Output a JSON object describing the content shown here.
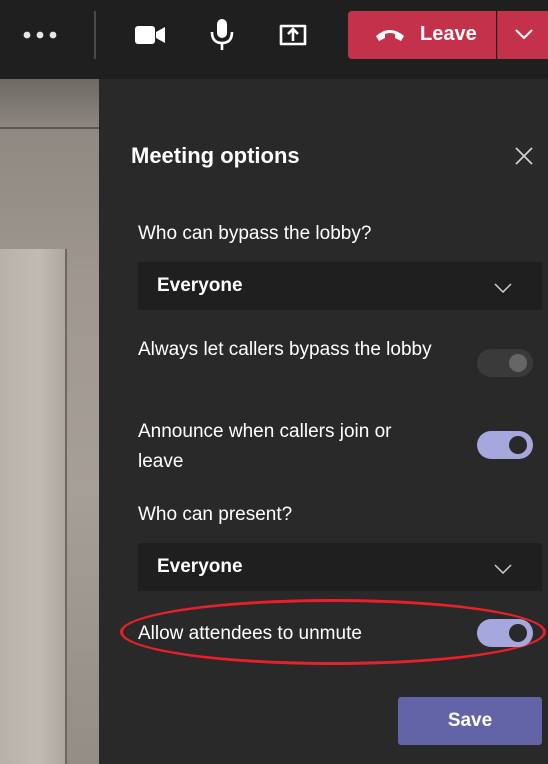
{
  "toolbar": {
    "more_icon": "more-dots-icon",
    "camera_icon": "video-camera-icon",
    "mic_icon": "microphone-icon",
    "share_icon": "share-screen-icon",
    "leave_label": "Leave",
    "leave_color": "#c4314b"
  },
  "panel": {
    "title": "Meeting options",
    "bypass_lobby_label": "Who can bypass the lobby?",
    "bypass_lobby_value": "Everyone",
    "callers_bypass_label": "Always let callers bypass the lobby",
    "callers_bypass_enabled": false,
    "announce_label": "Announce when callers join or leave",
    "announce_enabled": true,
    "present_label": "Who can present?",
    "present_value": "Everyone",
    "unmute_label": "Allow attendees to unmute",
    "unmute_enabled": true,
    "save_label": "Save",
    "accent_color": "#6264a7",
    "toggle_on_color": "#a6a7dc",
    "highlight_color": "#e8202a"
  }
}
